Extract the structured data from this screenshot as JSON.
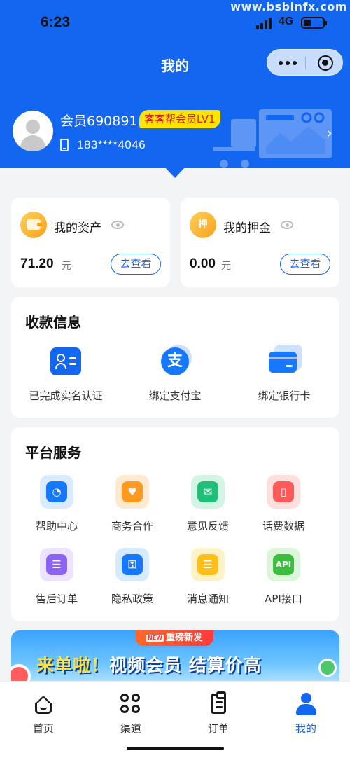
{
  "watermark": "www.bsbinfx.com",
  "status_bar": {
    "time": "6:23",
    "network": "4G"
  },
  "nav": {
    "title": "我的"
  },
  "profile": {
    "member_name": "会员690891",
    "level_badge": "客客帮会员LV1",
    "phone": "183****4046"
  },
  "assets": {
    "title": "我的资产",
    "amount": "71.20",
    "unit": "元",
    "button": "去查看"
  },
  "deposit": {
    "title": "我的押金",
    "icon_char": "押",
    "amount": "0.00",
    "unit": "元",
    "button": "去查看"
  },
  "payment": {
    "title": "收款信息",
    "items": [
      {
        "label": "已完成实名认证",
        "icon": "id-card-icon"
      },
      {
        "label": "绑定支付宝",
        "icon": "alipay-icon",
        "glyph": "支"
      },
      {
        "label": "绑定银行卡",
        "icon": "bank-card-icon"
      }
    ]
  },
  "services": {
    "title": "平台服务",
    "items": [
      {
        "label": "帮助中心",
        "icon": "headset-icon",
        "bg": "#d9ecff",
        "fg": "#1677ff",
        "glyph": "◔"
      },
      {
        "label": "商务合作",
        "icon": "handshake-heart-icon",
        "bg": "#ffe9cf",
        "fg": "#ff9a1f",
        "glyph": "♥"
      },
      {
        "label": "意见反馈",
        "icon": "mail-icon",
        "bg": "#d4f5e6",
        "fg": "#1fbf7a",
        "glyph": "✉"
      },
      {
        "label": "话费数据",
        "icon": "phone-bill-icon",
        "bg": "#ffdede",
        "fg": "#ff5a5a",
        "glyph": "▯"
      },
      {
        "label": "售后订单",
        "icon": "after-sale-icon",
        "bg": "#ebe3ff",
        "fg": "#8b64f3",
        "glyph": "☰"
      },
      {
        "label": "隐私政策",
        "icon": "privacy-shield-icon",
        "bg": "#d6ebff",
        "fg": "#1677ff",
        "glyph": "⚿"
      },
      {
        "label": "消息通知",
        "icon": "chat-bubble-icon",
        "bg": "#fff2c7",
        "fg": "#ffbf1a",
        "glyph": "☰"
      },
      {
        "label": "API接口",
        "icon": "api-icon",
        "bg": "#ddf5d8",
        "fg": "#3dbd3d",
        "glyph": "API"
      }
    ]
  },
  "banner": {
    "tag_new": "NEW",
    "tag": "重磅新发",
    "text_a": "来单啦！",
    "text_b": "视频会员 结算价高"
  },
  "tabbar": {
    "items": [
      {
        "label": "首页",
        "icon": "home-icon",
        "active": false
      },
      {
        "label": "渠道",
        "icon": "channel-grid-icon",
        "active": false
      },
      {
        "label": "订单",
        "icon": "order-clipboard-icon",
        "active": false
      },
      {
        "label": "我的",
        "icon": "profile-icon",
        "active": true
      }
    ]
  },
  "colors": {
    "brand_blue": "#1366f0",
    "badge_yellow": "#ffe500",
    "badge_text": "#e21d1d"
  }
}
